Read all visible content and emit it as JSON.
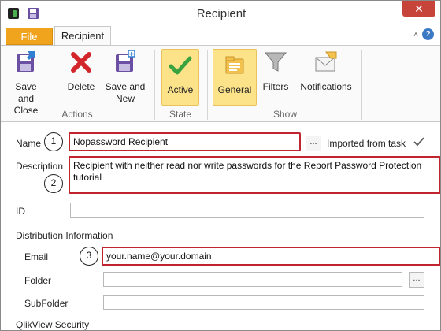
{
  "window": {
    "title": "Recipient",
    "close_label": "✕"
  },
  "tabs": {
    "file": "File",
    "recipient": "Recipient",
    "collapse_label": "˄",
    "help_label": "?"
  },
  "ribbon": {
    "groups": [
      {
        "label": "Actions"
      },
      {
        "label": "State"
      },
      {
        "label": "Show"
      }
    ],
    "buttons": {
      "save_close": "Save and\nClose",
      "delete": "Delete",
      "save_new": "Save and\nNew",
      "active": "Active",
      "general": "General",
      "filters": "Filters",
      "notifications": "Notifications"
    }
  },
  "form": {
    "name_label": "Name",
    "name_value": "Nopassword Recipient",
    "name_browse": "...",
    "imported_label": "Imported from task",
    "description_label": "Description",
    "description_value": "Recipient with neither read nor write passwords for the Report Password Protection tutorial",
    "id_label": "ID",
    "id_value": "",
    "distribution_section": "Distribution Information",
    "email_label": "Email",
    "email_value": "your.name@your.domain",
    "folder_label": "Folder",
    "folder_value": "",
    "folder_browse": "...",
    "subfolder_label": "SubFolder",
    "subfolder_value": "",
    "security_section": "QlikView Security"
  },
  "markers": [
    "1",
    "2",
    "3"
  ],
  "colors": {
    "file_tab": "#f0a41e",
    "highlight": "#c0242e",
    "active_button": "#fce38a",
    "close_button": "#c7443a"
  }
}
